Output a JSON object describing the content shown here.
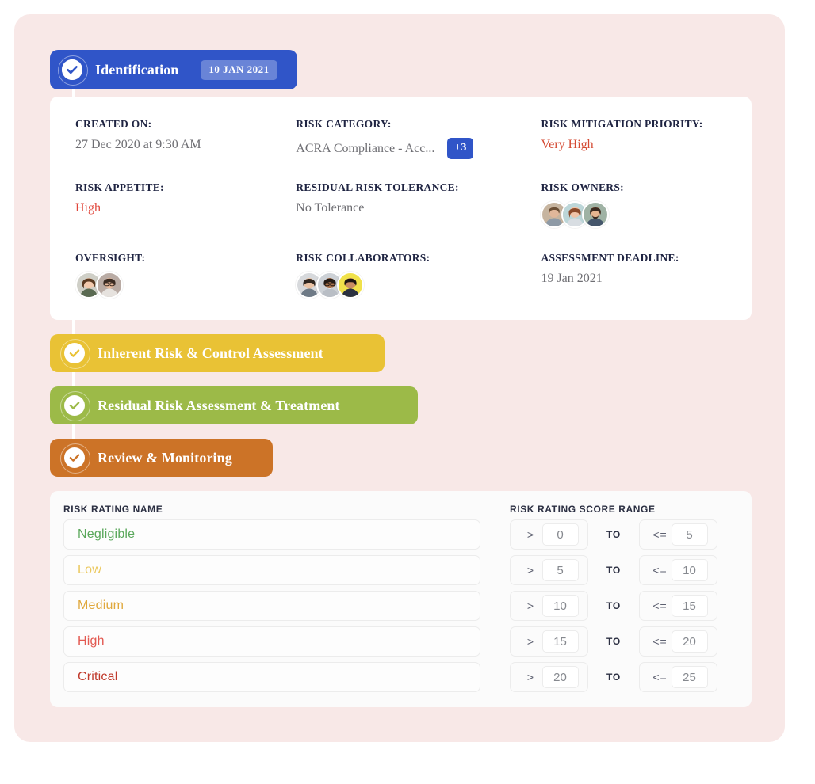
{
  "workflow": {
    "stages": [
      {
        "id": "identification",
        "label": "Identification",
        "date": "10 JAN 2021",
        "color": "#3055c8",
        "state": "complete"
      },
      {
        "id": "inherent",
        "label": "Inherent Risk & Control Assessment",
        "color": "#e9c235",
        "state": "complete"
      },
      {
        "id": "residual",
        "label": "Residual Risk Assessment & Treatment",
        "color": "#9cba48",
        "state": "complete"
      },
      {
        "id": "review",
        "label": "Review & Monitoring",
        "color": "#cc7327",
        "state": "complete"
      }
    ]
  },
  "details": {
    "created_on": {
      "label": "CREATED ON:",
      "value": "27 Dec 2020 at 9:30 AM"
    },
    "risk_category": {
      "label": "RISK CATEGORY:",
      "value": "ACRA Compliance - Acc...",
      "more_badge": "+3"
    },
    "risk_mitigation_priority": {
      "label": "RISK MITIGATION PRIORITY:",
      "value": "Very High",
      "value_color": "#d44a33"
    },
    "risk_appetite": {
      "label": "RISK APPETITE:",
      "value": "High",
      "value_color": "#e0453a"
    },
    "residual_risk_tolerance": {
      "label": "RESIDUAL RISK TOLERANCE:",
      "value": "No Tolerance"
    },
    "risk_owners": {
      "label": "RISK OWNERS:",
      "count": 3
    },
    "oversight": {
      "label": "OVERSIGHT:",
      "count": 2
    },
    "risk_collaborators": {
      "label": "RISK COLLABORATORS:",
      "count": 3
    },
    "assessment_deadline": {
      "label": "ASSESSMENT DEADLINE:",
      "value": "19 Jan 2021"
    }
  },
  "ratings": {
    "headers": {
      "name": "RISK RATING NAME",
      "range": "RISK RATING SCORE RANGE"
    },
    "to_label": "TO",
    "lower_operator": ">",
    "upper_operator": "<=",
    "rows": [
      {
        "name": "Negligible",
        "color": "#5ba85c",
        "min": "0",
        "max": "5"
      },
      {
        "name": "Low",
        "color": "#ebc85e",
        "min": "5",
        "max": "10"
      },
      {
        "name": "Medium",
        "color": "#e0a83c",
        "min": "10",
        "max": "15"
      },
      {
        "name": "High",
        "color": "#e35a52",
        "min": "15",
        "max": "20"
      },
      {
        "name": "Critical",
        "color": "#c0392b",
        "min": "20",
        "max": "25"
      }
    ]
  },
  "theme": {
    "panel_background": "#f8e8e7",
    "card_background": "#ffffff",
    "accent_blue": "#3055c8"
  }
}
